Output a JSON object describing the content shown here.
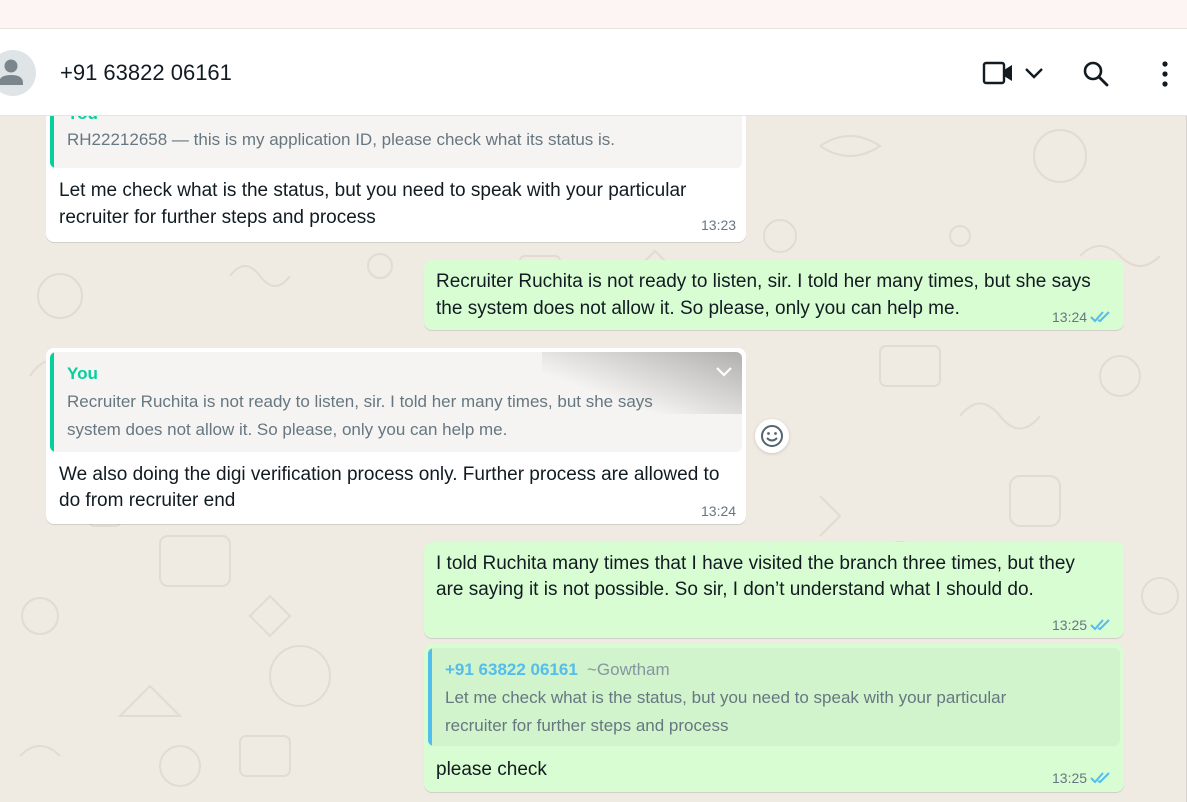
{
  "header": {
    "contact": "+91 63822 06161"
  },
  "icons": {
    "avatar": "person-icon",
    "video": "video-call-icon",
    "video_menu": "chevron-down-icon",
    "search": "search-icon",
    "menu": "kebab-menu-icon",
    "reaction": "emoji-icon",
    "read": "double-check-icon"
  },
  "colors": {
    "chat_background": "#efeae2",
    "incoming_bubble": "#ffffff",
    "outgoing_bubble": "#d9fdd3",
    "quote_you_accent": "#06cf9c",
    "quote_contact_accent": "#53bdeb",
    "read_ticks": "#53bdeb"
  },
  "messages": [
    {
      "quote_author": "You",
      "quote_text": "RH22212658 — this is my application ID, please check what its status is.",
      "text_line1": "Let me check what is the status, but you need to speak with your particular",
      "text_line2": "recruiter for further steps and process",
      "time": "13:23"
    },
    {
      "text_line1": "Recruiter Ruchita is not ready to listen, sir. I told her many times, but she says",
      "text_line2": "the system does not allow it. So please, only you can help me.",
      "time": "13:24"
    },
    {
      "quote_author": "You",
      "quote_line1": "Recruiter Ruchita is not ready to listen, sir. I told her many times, but she says",
      "quote_line2": "system does not allow it. So please, only you can help me.",
      "text_line1": "We also doing the digi verification process only. Further process are allowed to",
      "text_line2": "do from recruiter end",
      "time": "13:24"
    },
    {
      "text_line1": "I told Ruchita many times that I have visited the branch three times, but they",
      "text_line2": "are saying it is not possible. So sir, I don’t understand what I should do.",
      "time": "13:25"
    },
    {
      "quote_author": "+91 63822 06161",
      "quote_pushname": "~Gowtham",
      "quote_line1": "Let me check what is the status, but you need to speak with your particular",
      "quote_line2": "recruiter for further steps and process",
      "text": "please check",
      "time": "13:25"
    }
  ]
}
